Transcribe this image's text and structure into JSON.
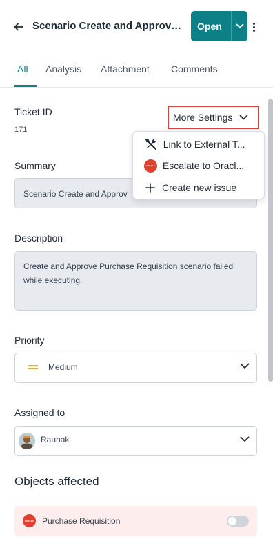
{
  "header": {
    "title": "Scenario Create and Approve ...",
    "open_label": "Open",
    "icons": {
      "back": "arrow-left-icon",
      "chevron": "chevron-down-icon",
      "more": "kebab-icon"
    }
  },
  "tabs": [
    {
      "label": "All",
      "active": true
    },
    {
      "label": "Analysis",
      "active": false
    },
    {
      "label": "Attachment",
      "active": false
    },
    {
      "label": "Comments",
      "active": false
    }
  ],
  "ticket": {
    "id_label": "Ticket ID",
    "id_value": "171"
  },
  "more_settings": {
    "label": "More Settings",
    "menu": [
      {
        "label": "Link to External T...",
        "icon": "tools-icon"
      },
      {
        "label": "Escalate to Oracl...",
        "icon": "oracle-logo-icon"
      },
      {
        "label": "Create new issue",
        "icon": "plus-icon"
      }
    ]
  },
  "summary": {
    "label": "Summary",
    "value": "Scenario Create and Approv"
  },
  "description": {
    "label": "Description",
    "value": "Create and Approve Purchase Requisition scenario failed while executing."
  },
  "priority": {
    "label": "Priority",
    "value": "Medium",
    "color": "#f5a623"
  },
  "assigned": {
    "label": "Assigned to",
    "value": "Raunak"
  },
  "objects": {
    "title": "Objects affected",
    "items": [
      {
        "label": "Purchase Requisition",
        "enabled": false
      }
    ]
  },
  "colors": {
    "accent": "#0d7f86",
    "highlight_border": "#e0403a",
    "oracle_red": "#e2402e"
  }
}
